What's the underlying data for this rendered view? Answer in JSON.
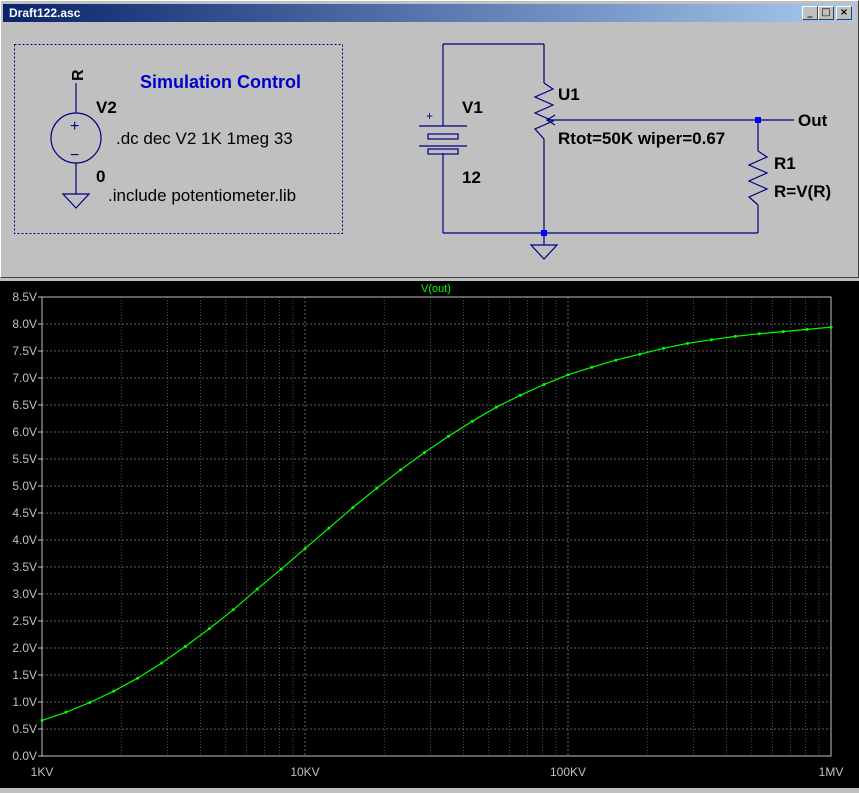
{
  "window": {
    "title": "Draft122.asc"
  },
  "controls": {
    "minimize": "_",
    "maximize": "□",
    "close": "×"
  },
  "schematic": {
    "sim_control": "Simulation Control",
    "v2_name": "V2",
    "v2_node_top": "R",
    "v2_node_bottom": "0",
    "directive_dc": ".dc dec V2 1K 1meg 33",
    "directive_include": ".include potentiometer.lib",
    "v1_name": "V1",
    "v1_value": "12",
    "v1_plus": "+",
    "v2_plus": "+",
    "v2_minus": "−",
    "u1_name": "U1",
    "u1_params": "Rtot=50K wiper=0.67",
    "r1_name": "R1",
    "r1_value": "R=V(R)",
    "out_label": "Out"
  },
  "colors": {
    "wire": "#000080",
    "component": "#000080",
    "node_dot": "#0000ff",
    "directive_border": "#000080",
    "sim_control_text": "#0000cc",
    "plot_bg": "#000000",
    "trace": "#00ff00",
    "axis_text": "#c0c0c0",
    "grid": "#808080"
  },
  "chart_data": {
    "type": "line",
    "title": "V(out)",
    "x_scale": "log",
    "xlim": [
      1000,
      1000000
    ],
    "ylim": [
      0,
      8.5
    ],
    "x_ticks": [
      {
        "value": 1000,
        "label": "1KV"
      },
      {
        "value": 10000,
        "label": "10KV"
      },
      {
        "value": 100000,
        "label": "100KV"
      },
      {
        "value": 1000000,
        "label": "1MV"
      }
    ],
    "y_ticks": [
      {
        "value": 0,
        "label": "0.0V"
      },
      {
        "value": 0.5,
        "label": "0.5V"
      },
      {
        "value": 1,
        "label": "1.0V"
      },
      {
        "value": 1.5,
        "label": "1.5V"
      },
      {
        "value": 2,
        "label": "2.0V"
      },
      {
        "value": 2.5,
        "label": "2.5V"
      },
      {
        "value": 3,
        "label": "3.0V"
      },
      {
        "value": 3.5,
        "label": "3.5V"
      },
      {
        "value": 4,
        "label": "4.0V"
      },
      {
        "value": 4.5,
        "label": "4.5V"
      },
      {
        "value": 5,
        "label": "5.0V"
      },
      {
        "value": 5.5,
        "label": "5.5V"
      },
      {
        "value": 6,
        "label": "6.0V"
      },
      {
        "value": 6.5,
        "label": "6.5V"
      },
      {
        "value": 7,
        "label": "7.0V"
      },
      {
        "value": 7.5,
        "label": "7.5V"
      },
      {
        "value": 8,
        "label": "8.0V"
      },
      {
        "value": 8.5,
        "label": "8.5V"
      }
    ],
    "grid": true,
    "series": [
      {
        "name": "V(out)",
        "x": [
          1000,
          1233,
          1520,
          1874,
          2310,
          2848,
          3511,
          4329,
          5337,
          6579,
          8111,
          10000,
          12328,
          15199,
          18738,
          23101,
          28480,
          35112,
          43288,
          53367,
          65793,
          81113,
          100000,
          123285,
          151991,
          187382,
          231013,
          284804,
          351119,
          432876,
          533670,
          657933,
          811131,
          1000000
        ],
        "y": [
          0.66,
          0.81,
          0.99,
          1.2,
          1.44,
          1.72,
          2.03,
          2.36,
          2.71,
          3.09,
          3.46,
          3.84,
          4.22,
          4.6,
          4.96,
          5.3,
          5.62,
          5.92,
          6.2,
          6.46,
          6.68,
          6.88,
          7.06,
          7.2,
          7.33,
          7.44,
          7.55,
          7.64,
          7.71,
          7.77,
          7.82,
          7.86,
          7.9,
          7.94
        ]
      }
    ]
  }
}
